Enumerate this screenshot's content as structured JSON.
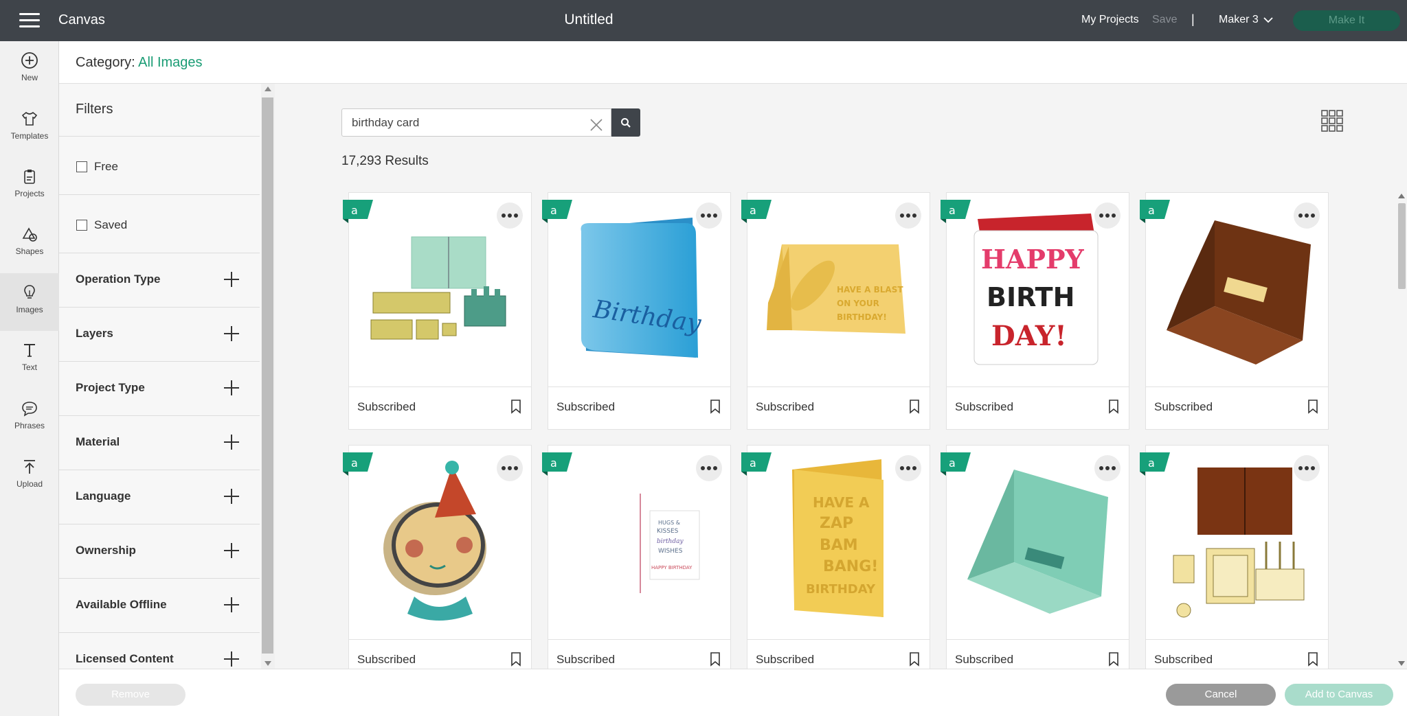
{
  "topbar": {
    "app_name": "Canvas",
    "doc_title": "Untitled",
    "my_projects": "My Projects",
    "save": "Save",
    "separator": "|",
    "machine": "Maker 3",
    "make_it": "Make It"
  },
  "rail": {
    "items": [
      {
        "label": "New",
        "icon": "plus-circle-icon"
      },
      {
        "label": "Templates",
        "icon": "shirt-icon"
      },
      {
        "label": "Projects",
        "icon": "clipboard-icon"
      },
      {
        "label": "Shapes",
        "icon": "shapes-icon"
      },
      {
        "label": "Images",
        "icon": "lightbulb-icon",
        "active": true
      },
      {
        "label": "Text",
        "icon": "text-icon"
      },
      {
        "label": "Phrases",
        "icon": "speech-bubble-icon"
      },
      {
        "label": "Upload",
        "icon": "upload-icon"
      }
    ]
  },
  "category": {
    "label": "Category:",
    "value": "All Images"
  },
  "filters": {
    "title": "Filters",
    "checkboxes": [
      {
        "label": "Free",
        "checked": false
      },
      {
        "label": "Saved",
        "checked": false
      }
    ],
    "sections": [
      "Operation Type",
      "Layers",
      "Project Type",
      "Material",
      "Language",
      "Ownership",
      "Available Offline",
      "Licensed Content"
    ]
  },
  "search": {
    "value": "birthday card",
    "placeholder": "Search"
  },
  "results_text": "17,293 Results",
  "cards": [
    {
      "label": "Subscribed",
      "art": "tan-card-kit"
    },
    {
      "label": "Subscribed",
      "art": "blue-birthday-card"
    },
    {
      "label": "Subscribed",
      "art": "yellow-rocket-card"
    },
    {
      "label": "Subscribed",
      "art": "ransom-letter-card"
    },
    {
      "label": "Subscribed",
      "art": "brown-popup-card"
    },
    {
      "label": "Subscribed",
      "art": "party-hat-kid"
    },
    {
      "label": "Subscribed",
      "art": "hugs-kisses-card"
    },
    {
      "label": "Subscribed",
      "art": "zap-bam-card"
    },
    {
      "label": "Subscribed",
      "art": "mint-popup-card"
    },
    {
      "label": "Subscribed",
      "art": "brown-cake-kit"
    }
  ],
  "art_text": {
    "blue_card": "Birthday",
    "rocket_card": [
      "HAVE A BLAST",
      "ON YOUR",
      "BIRTHDAY!"
    ],
    "ransom": [
      "HAPPY",
      "BIRTH",
      "DAY!"
    ],
    "hugs": [
      "HUGS &",
      "KISSES",
      "birthday",
      "WISHES",
      "HAPPY BIRTHDAY"
    ],
    "zap": [
      "HAVE A",
      "ZAP",
      "BAM",
      "BANG!",
      "BIRTHDAY"
    ]
  },
  "bottombar": {
    "remove": "Remove",
    "cancel": "Cancel",
    "add": "Add to Canvas"
  },
  "colors": {
    "accent": "#1a9c74",
    "topbar": "#3f444a"
  }
}
